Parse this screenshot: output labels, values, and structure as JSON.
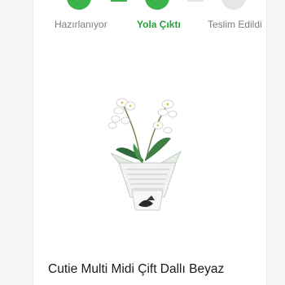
{
  "colors": {
    "active_green": "#3cb34a",
    "inactive_gray": "#e6e6e6",
    "label_gray": "#7d7d7d",
    "label_green": "#2e9e3e"
  },
  "tracker": {
    "steps": [
      {
        "label": "Hazırlanıyor",
        "state": "done",
        "icon": "check-icon"
      },
      {
        "label": "Yola Çıktı",
        "state": "current",
        "icon": "check-icon"
      },
      {
        "label": "Teslim Edildi",
        "state": "pending",
        "icon": ""
      }
    ]
  },
  "product": {
    "title": "Cutie Multi Midi Çift Dallı Beyaz",
    "image_icon": "orchid-plant-icon"
  }
}
